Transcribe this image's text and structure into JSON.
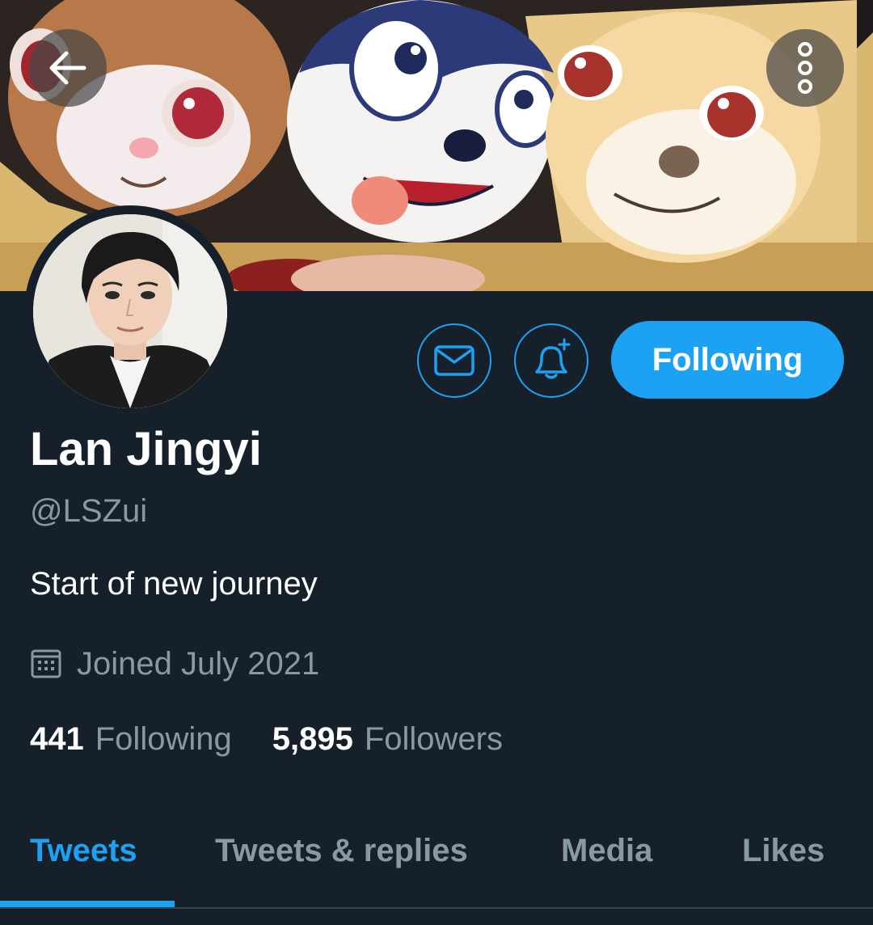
{
  "header": {
    "back_icon": "arrow-left-icon",
    "more_icon": "more-vertical-icon"
  },
  "profile": {
    "name": "Lan Jingyi",
    "handle": "@LSZui",
    "bio": "Start of new journey",
    "joined": "Joined July 2021",
    "following_count": "441",
    "following_label": "Following",
    "followers_count": "5,895",
    "followers_label": "Followers"
  },
  "actions": {
    "message_icon": "envelope-icon",
    "notify_icon": "bell-plus-icon",
    "follow_label": "Following"
  },
  "tabs": [
    {
      "label": "Tweets",
      "active": true
    },
    {
      "label": "Tweets & replies",
      "active": false
    },
    {
      "label": "Media",
      "active": false
    },
    {
      "label": "Likes",
      "active": false
    }
  ],
  "colors": {
    "background": "#15202b",
    "accent": "#1da1f2",
    "secondary_text": "#8899a6",
    "divider": "#38444d"
  }
}
